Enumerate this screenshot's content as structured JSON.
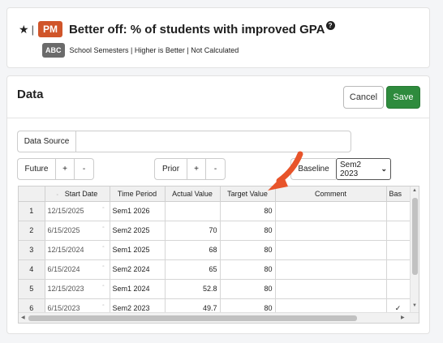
{
  "header": {
    "star_icon": "star-icon",
    "separator": "|",
    "badge": "PM",
    "title": "Better off: % of students with improved GPA",
    "help_icon": "question-circle-icon",
    "type_badge": "ABC",
    "meta": "School Semesters | Higher is Better | Not Calculated"
  },
  "data_panel": {
    "title": "Data",
    "cancel_label": "Cancel",
    "save_label": "Save",
    "data_source_label": "Data Source",
    "data_source_value": "",
    "future_label": "Future",
    "prior_label": "Prior",
    "plus": "+",
    "minus": "-",
    "baseline_label": "Baseline",
    "baseline_value": "Sem2 2023"
  },
  "grid": {
    "columns": [
      "",
      "Start Date",
      "Time Period",
      "Actual Value",
      "Target Value",
      "Comment",
      "Bas"
    ],
    "rows": [
      {
        "n": "1",
        "start": "12/15/2025",
        "period": "Sem1 2026",
        "actual": "",
        "target": "80",
        "comment": "",
        "base": ""
      },
      {
        "n": "2",
        "start": "6/15/2025",
        "period": "Sem2 2025",
        "actual": "70",
        "target": "80",
        "comment": "",
        "base": ""
      },
      {
        "n": "3",
        "start": "12/15/2024",
        "period": "Sem1 2025",
        "actual": "68",
        "target": "80",
        "comment": "",
        "base": ""
      },
      {
        "n": "4",
        "start": "6/15/2024",
        "period": "Sem2 2024",
        "actual": "65",
        "target": "80",
        "comment": "",
        "base": ""
      },
      {
        "n": "5",
        "start": "12/15/2023",
        "period": "Sem1 2024",
        "actual": "52.8",
        "target": "80",
        "comment": "",
        "base": ""
      },
      {
        "n": "6",
        "start": "6/15/2023",
        "period": "Sem2 2023",
        "actual": "49.7",
        "target": "80",
        "comment": "",
        "base": "✓"
      }
    ]
  },
  "colors": {
    "pm_badge": "#d0552a",
    "save_button": "#2e8b3d",
    "annotation_arrow": "#e8542a"
  }
}
